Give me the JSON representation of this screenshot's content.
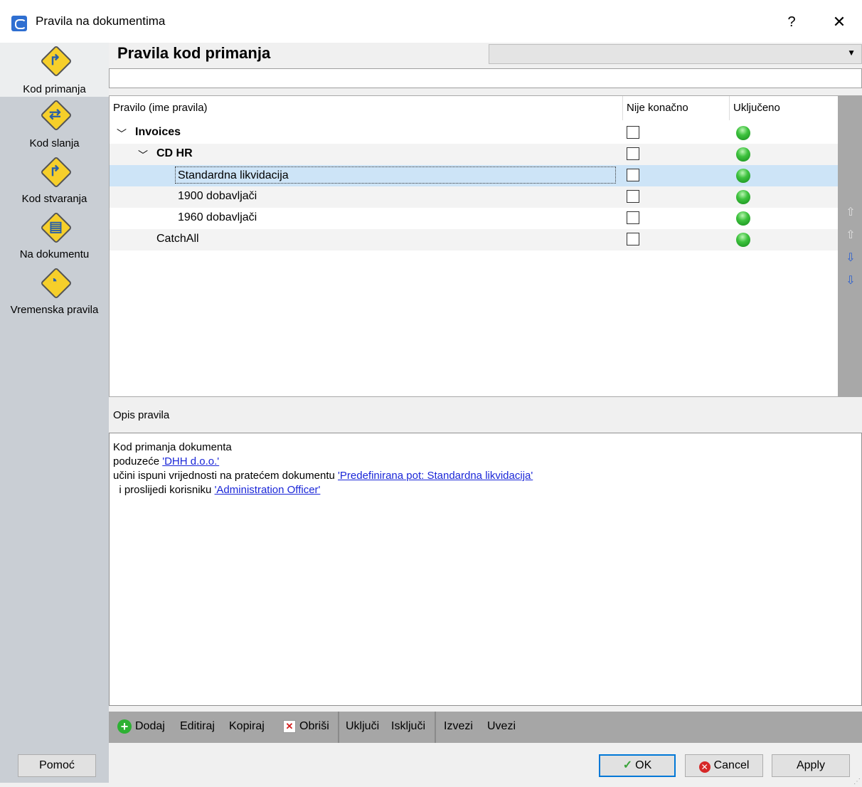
{
  "window": {
    "title": "Pravila na dokumentima",
    "help_label": "?",
    "close_label": "✕"
  },
  "nav": {
    "items": [
      {
        "label": "Kod primanja",
        "glyph": "↱",
        "active": true
      },
      {
        "label": "Kod slanja",
        "glyph": "⇄"
      },
      {
        "label": "Kod stvaranja",
        "glyph": "↱"
      },
      {
        "label": "Na dokumentu",
        "glyph": "▤"
      },
      {
        "label": "Vremenska pravila",
        "glyph": "◔"
      }
    ]
  },
  "header": {
    "title": "Pravila kod primanja",
    "combo_value": "",
    "combo_arrow": "▼",
    "description_value": ""
  },
  "grid": {
    "columns": [
      "Pravilo (ime pravila)",
      "Nije konačno",
      "Uključeno"
    ],
    "rows": [
      {
        "name": "Invoices",
        "level": 0,
        "expander": "﹀",
        "bold": true,
        "nije_konacno": false,
        "ukljuceno": true
      },
      {
        "name": "CD HR",
        "level": 1,
        "expander": "﹀",
        "bold": true,
        "nije_konacno": false,
        "ukljuceno": true
      },
      {
        "name": "Standardna likvidacija",
        "level": 2,
        "selected": true,
        "nije_konacno": false,
        "ukljuceno": true
      },
      {
        "name": "1900 dobavljači",
        "level": 2,
        "nije_konacno": false,
        "ukljuceno": true
      },
      {
        "name": "1960 dobavljači",
        "level": 2,
        "nije_konacno": false,
        "ukljuceno": true
      },
      {
        "name": "CatchAll",
        "level": 1,
        "nije_konacno": false,
        "ukljuceno": true
      }
    ]
  },
  "move_buttons": {
    "top": "⇧",
    "up": "⇧",
    "down": "⇩",
    "bottom": "⇩"
  },
  "description": {
    "label": "Opis pravila",
    "line1": "Kod primanja dokumenta",
    "line2_prefix": "poduzeće ",
    "line2_link": "'DHH d.o.o.'",
    "line3_prefix": "učini ispuni vrijednosti na pratećem dokumentu ",
    "line3_link": "'Predefinirana pot: Standardna likvidacija'",
    "line4_prefix": "  i proslijedi korisniku ",
    "line4_link": "'Administration Officer'"
  },
  "toolbar": {
    "add_icon": "+",
    "add": "Dodaj",
    "edit": "Editiraj",
    "copy": "Kopiraj",
    "delete_icon": "✕",
    "delete": "Obriši",
    "enable": "Uključi",
    "disable": "Isključi",
    "export": "Izvezi",
    "import": "Uvezi"
  },
  "buttons": {
    "help": "Pomoć",
    "ok_icon": "✓",
    "ok": "OK",
    "cancel_icon": "✕",
    "cancel": "Cancel",
    "apply": "Apply"
  }
}
